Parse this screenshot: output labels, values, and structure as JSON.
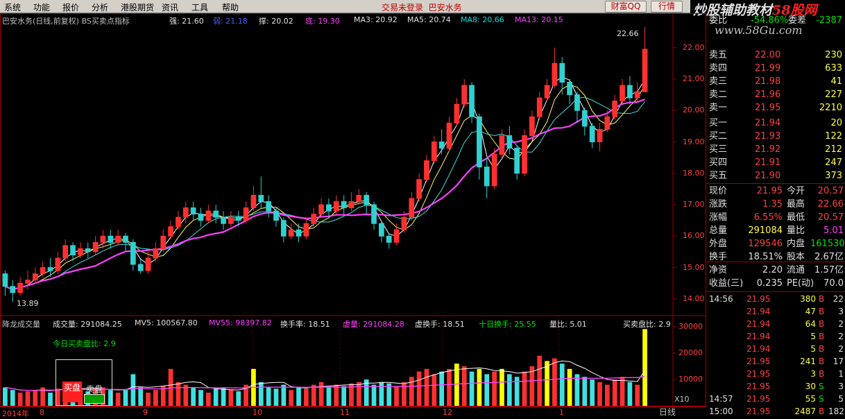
{
  "menu": {
    "items": [
      "系统",
      "功能",
      "报价",
      "分析",
      "港股期货",
      "资讯",
      "工具",
      "帮助"
    ],
    "status_text": "交易未登录",
    "stock_name": "巴安水务",
    "btn_wealth": "财富QQ",
    "btn_quote": "行情"
  },
  "watermark": {
    "text_a": "炒股辅助教材",
    "text_b": "58股网",
    "url": "www.58Gu.com"
  },
  "info": {
    "title": "巴安水务(日线,前复权) BS买卖点指标",
    "qiang": "强: 21.60",
    "ruo": "弱: 21.18",
    "cheng": "撑: 20.02",
    "di": "底: 19.30",
    "ma3": "MA3: 20.92",
    "ma5": "MA5: 20.74",
    "ma8": "MA8: 20.66",
    "ma13": "MA13: 20.15"
  },
  "vol_info": {
    "title": "降龙成交量",
    "cjl": "成交量: 291084.25",
    "mv5": "MV5: 100567.80",
    "mv55": "MV55: 98397.82",
    "hsl": "换手率: 18.51",
    "xl": "虚量: 291084.28",
    "xhs": "虚换手: 18.51",
    "sr": "十日换手: 25.55",
    "lb": "量比: 5.01",
    "mmpb": "买卖盘比: 2.9",
    "today_ratio": "今日买卖盘比: 2.9",
    "buy_label": "买盘",
    "sell_label": "卖盘"
  },
  "price_axis": [
    "22.00",
    "21.00",
    "20.00",
    "19.00",
    "18.00",
    "17.00",
    "16.00",
    "15.00",
    "14.00"
  ],
  "vol_axis": [
    "30000",
    "20000",
    "10000"
  ],
  "vol_unit": "X10",
  "annotations": {
    "high": "22.66",
    "low": "13.89"
  },
  "bottom": {
    "year": "2014年",
    "months": [
      "8",
      "9",
      "10",
      "11",
      "12",
      "1"
    ],
    "tab": "日线"
  },
  "chart_data": {
    "type": "candlestick",
    "price_range": [
      13.6,
      22.7
    ],
    "volume_range": [
      0,
      30000
    ],
    "candles": [
      [
        14.8,
        14.4,
        14.9,
        14.1
      ],
      [
        14.4,
        14.2,
        14.6,
        13.9
      ],
      [
        14.2,
        14.5,
        14.7,
        14.1
      ],
      [
        14.5,
        14.6,
        14.9,
        14.3
      ],
      [
        14.6,
        14.8,
        15.0,
        14.5
      ],
      [
        14.8,
        15.0,
        15.2,
        14.7
      ],
      [
        15.0,
        14.9,
        15.3,
        14.7
      ],
      [
        14.9,
        15.3,
        15.5,
        14.8
      ],
      [
        15.3,
        15.7,
        15.9,
        15.2
      ],
      [
        15.7,
        15.4,
        15.8,
        15.2
      ],
      [
        15.4,
        15.6,
        15.8,
        15.3
      ],
      [
        15.6,
        15.5,
        15.8,
        15.3
      ],
      [
        15.5,
        15.8,
        16.0,
        15.4
      ],
      [
        15.8,
        16.0,
        16.2,
        15.6
      ],
      [
        16.0,
        15.8,
        16.2,
        15.6
      ],
      [
        15.8,
        16.0,
        16.2,
        15.7
      ],
      [
        16.0,
        15.8,
        16.1,
        15.5
      ],
      [
        15.8,
        15.1,
        15.9,
        14.9
      ],
      [
        15.1,
        14.9,
        15.3,
        14.8
      ],
      [
        14.9,
        15.3,
        15.5,
        14.8
      ],
      [
        15.3,
        15.6,
        15.8,
        15.2
      ],
      [
        15.6,
        16.0,
        16.2,
        15.5
      ],
      [
        16.0,
        16.3,
        16.5,
        15.9
      ],
      [
        16.3,
        16.6,
        16.8,
        16.2
      ],
      [
        16.6,
        16.9,
        17.1,
        16.4
      ],
      [
        16.9,
        16.7,
        17.1,
        16.5
      ],
      [
        16.7,
        16.5,
        16.9,
        16.3
      ],
      [
        16.5,
        16.8,
        17.0,
        16.4
      ],
      [
        16.8,
        16.6,
        17.0,
        16.4
      ],
      [
        16.6,
        16.4,
        16.8,
        16.2
      ],
      [
        16.4,
        16.6,
        16.8,
        16.3
      ],
      [
        16.6,
        16.5,
        16.8,
        16.3
      ],
      [
        16.5,
        16.9,
        17.1,
        16.4
      ],
      [
        16.9,
        17.3,
        17.6,
        16.8
      ],
      [
        17.3,
        17.1,
        17.9,
        16.9
      ],
      [
        17.1,
        16.8,
        17.3,
        16.6
      ],
      [
        16.8,
        16.5,
        16.9,
        16.3
      ],
      [
        16.5,
        16.0,
        16.6,
        15.8
      ],
      [
        16.0,
        16.2,
        16.4,
        15.9
      ],
      [
        16.2,
        16.0,
        16.4,
        15.8
      ],
      [
        16.0,
        16.4,
        16.6,
        15.9
      ],
      [
        16.4,
        16.7,
        16.9,
        16.3
      ],
      [
        16.7,
        17.0,
        17.2,
        16.6
      ],
      [
        17.0,
        16.8,
        17.2,
        16.6
      ],
      [
        16.8,
        17.1,
        17.3,
        16.7
      ],
      [
        17.1,
        16.9,
        17.3,
        16.7
      ],
      [
        16.9,
        17.1,
        17.4,
        16.8
      ],
      [
        17.1,
        17.3,
        17.5,
        17.0
      ],
      [
        17.3,
        17.0,
        17.4,
        16.7
      ],
      [
        17.0,
        16.4,
        17.1,
        16.2
      ],
      [
        16.4,
        16.0,
        16.5,
        15.8
      ],
      [
        16.0,
        15.8,
        16.1,
        15.6
      ],
      [
        15.8,
        16.2,
        16.4,
        15.7
      ],
      [
        16.2,
        16.6,
        16.8,
        16.1
      ],
      [
        16.6,
        17.2,
        17.4,
        16.5
      ],
      [
        17.2,
        17.8,
        18.0,
        17.1
      ],
      [
        17.8,
        18.4,
        18.6,
        17.7
      ],
      [
        18.4,
        19.0,
        19.2,
        18.3
      ],
      [
        19.0,
        18.8,
        19.4,
        18.6
      ],
      [
        18.8,
        19.6,
        19.8,
        18.7
      ],
      [
        19.6,
        20.2,
        20.4,
        19.5
      ],
      [
        20.2,
        20.8,
        21.0,
        20.1
      ],
      [
        20.8,
        19.8,
        20.9,
        19.6
      ],
      [
        19.8,
        18.2,
        19.9,
        17.8
      ],
      [
        18.2,
        17.6,
        18.5,
        17.2
      ],
      [
        17.6,
        18.6,
        18.8,
        17.5
      ],
      [
        18.6,
        19.2,
        19.4,
        18.5
      ],
      [
        19.2,
        18.8,
        19.5,
        18.6
      ],
      [
        18.8,
        18.0,
        18.9,
        17.8
      ],
      [
        18.0,
        19.2,
        19.4,
        17.9
      ],
      [
        19.2,
        19.8,
        20.0,
        19.1
      ],
      [
        19.8,
        20.4,
        20.6,
        19.7
      ],
      [
        20.4,
        20.8,
        21.0,
        20.3
      ],
      [
        20.8,
        21.5,
        22.0,
        20.7
      ],
      [
        21.5,
        20.9,
        21.7,
        20.5
      ],
      [
        20.9,
        20.5,
        21.0,
        20.2
      ],
      [
        20.5,
        20.0,
        20.6,
        19.6
      ],
      [
        20.0,
        19.5,
        20.1,
        19.2
      ],
      [
        19.5,
        19.0,
        19.6,
        18.8
      ],
      [
        19.0,
        19.4,
        19.6,
        18.7
      ],
      [
        19.4,
        19.8,
        20.0,
        19.3
      ],
      [
        19.8,
        20.3,
        20.5,
        19.7
      ],
      [
        20.3,
        20.8,
        21.0,
        20.2
      ],
      [
        20.8,
        20.4,
        21.1,
        20.2
      ],
      [
        20.4,
        20.6,
        20.9,
        20.3
      ],
      [
        20.6,
        21.95,
        22.66,
        20.57
      ]
    ],
    "volumes": [
      7000,
      6000,
      5000,
      5500,
      6000,
      7000,
      5000,
      6500,
      8000,
      7000,
      6000,
      5500,
      6500,
      7000,
      6000,
      5000,
      6000,
      12000,
      7000,
      5000,
      6000,
      7500,
      14000,
      9000,
      8000,
      7000,
      6000,
      5000,
      6500,
      7000,
      6000,
      5500,
      8000,
      14000,
      9000,
      7000,
      6500,
      8000,
      6000,
      7000,
      6500,
      8000,
      9000,
      7000,
      8000,
      7500,
      8500,
      9000,
      10000,
      8000,
      9000,
      8500,
      7500,
      9000,
      11000,
      13000,
      14000,
      12000,
      13000,
      14000,
      16000,
      15000,
      13000,
      14000,
      12000,
      13000,
      14000,
      12000,
      11000,
      13000,
      15000,
      19000,
      17000,
      18000,
      16000,
      14000,
      12000,
      11000,
      10000,
      9000,
      8000,
      10000,
      11000,
      9000,
      8000,
      29108
    ]
  },
  "panel": {
    "weibi": "委比",
    "weibi_val": "-54.86%",
    "weicha": "委差",
    "weicha_val": "-2387",
    "sell": [
      [
        "卖五",
        "22.00",
        "230"
      ],
      [
        "卖四",
        "21.99",
        "633"
      ],
      [
        "卖三",
        "21.98",
        "41"
      ],
      [
        "卖二",
        "21.96",
        "227"
      ],
      [
        "卖一",
        "21.95",
        "2210"
      ]
    ],
    "buy": [
      [
        "买一",
        "21.94",
        "20"
      ],
      [
        "买二",
        "21.93",
        "122"
      ],
      [
        "买三",
        "21.92",
        "212"
      ],
      [
        "买四",
        "21.91",
        "247"
      ],
      [
        "买五",
        "21.90",
        "373"
      ]
    ],
    "stats": [
      [
        "现价",
        "21.95",
        "今开",
        "20.57"
      ],
      [
        "涨跌",
        "1.35",
        "最高",
        "22.66"
      ],
      [
        "涨幅",
        "6.55%",
        "最低",
        "20.57"
      ],
      [
        "总量",
        "291084",
        "量比",
        "5.01"
      ],
      [
        "外盘",
        "129546",
        "内盘",
        "161530"
      ],
      [
        "换手",
        "18.51%",
        "股本",
        "2.67亿"
      ],
      [
        "净资",
        "2.20",
        "流通",
        "1.57亿"
      ],
      [
        "收益(三)",
        "0.235",
        "PE(动)",
        "70.0"
      ]
    ],
    "ticks": [
      [
        "14:56",
        "21.95",
        "380",
        "B",
        "22"
      ],
      [
        "",
        "21.94",
        "47",
        "B",
        "3"
      ],
      [
        "",
        "21.94",
        "64",
        "B",
        "2"
      ],
      [
        "",
        "21.94",
        "5",
        "B",
        "2"
      ],
      [
        "",
        "21.94",
        "5",
        "B",
        "2"
      ],
      [
        "",
        "21.95",
        "241",
        "B",
        "17"
      ],
      [
        "",
        "21.95",
        "3",
        "B",
        "1"
      ],
      [
        "",
        "21.95",
        "30",
        "S",
        "3"
      ],
      [
        "14:57",
        "21.95",
        "55",
        "S",
        "5"
      ],
      [
        "15:00",
        "21.95",
        "2487",
        "B",
        "182"
      ]
    ]
  }
}
